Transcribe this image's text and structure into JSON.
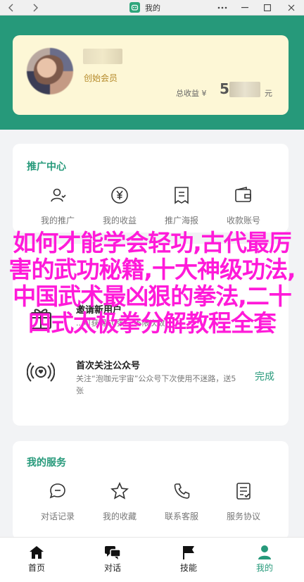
{
  "window": {
    "title": "我的"
  },
  "profile": {
    "member_level": "创始会员",
    "earnings_label": "总收益 ¥",
    "earnings_visible_prefix": "5",
    "earnings_unit": "元"
  },
  "promotion": {
    "title": "推广中心",
    "items": [
      {
        "label": "我的推广",
        "icon": "person-icon"
      },
      {
        "label": "我的收益",
        "icon": "yen-coin-icon"
      },
      {
        "label": "推广海报",
        "icon": "poster-icon"
      },
      {
        "label": "收款账号",
        "icon": "wallet-icon"
      }
    ]
  },
  "invite": {
    "title": "邀请新用户",
    "desc": "...可获得50张...,不限次数"
  },
  "follow": {
    "title": "首次关注公众号",
    "desc": "关注“泡咖元宇宙”公众号下次使用不迷路，送5张",
    "action": "完成"
  },
  "services": {
    "title": "我的服务",
    "items": [
      {
        "label": "对话记录",
        "icon": "chat-record-icon"
      },
      {
        "label": "我的收藏",
        "icon": "star-icon"
      },
      {
        "label": "联系客服",
        "icon": "phone-icon"
      },
      {
        "label": "服务协议",
        "icon": "document-icon"
      }
    ]
  },
  "overlay_text": "如何才能学会轻功,古代最厉害的武功秘籍,十大神级功法,中国武术最凶狠的拳法,二十四式太极拳分解教程全套",
  "tabs": [
    {
      "label": "首页",
      "icon": "home-icon"
    },
    {
      "label": "对话",
      "icon": "chat-icon"
    },
    {
      "label": "技能",
      "icon": "flag-icon"
    },
    {
      "label": "我的",
      "icon": "user-icon",
      "active": true
    }
  ],
  "colors": {
    "brand": "#26997a",
    "card_gold": "#fdf7d6",
    "overlay": "#ff1ad9"
  }
}
